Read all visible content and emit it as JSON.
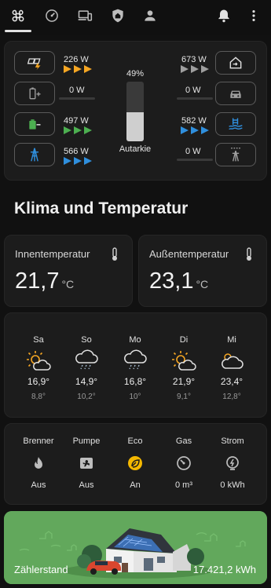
{
  "nav": {
    "tabs": [
      "commands-icon",
      "speedometer-icon",
      "devices-icon",
      "home-shield-icon",
      "person-icon"
    ],
    "active_tab": 0,
    "right": [
      "bell-icon",
      "more-vert-icon"
    ]
  },
  "energy": {
    "solar": {
      "value": "226 W",
      "icon": "solar-power-icon",
      "color": "#f5a623"
    },
    "battery_charge": {
      "value": "0 W",
      "icon": "battery-plus-icon"
    },
    "battery_discharge": {
      "value": "497 W",
      "icon": "battery-minus-icon",
      "color": "#4caf50"
    },
    "grid_import": {
      "value": "566 W",
      "icon": "transmission-tower-icon",
      "color": "#2f8fdd"
    },
    "house": {
      "value": "673 W",
      "icon": "home-import-icon"
    },
    "car": {
      "value": "0 W",
      "icon": "car-icon"
    },
    "pool": {
      "value": "582 W",
      "icon": "pool-heat-icon",
      "color": "#2f8fdd"
    },
    "grid_export": {
      "value": "0 W",
      "icon": "transmission-tower-export-icon"
    },
    "autarkie": {
      "percent_label": "49%",
      "fraction": 0.49,
      "label": "Autarkie"
    }
  },
  "section_title": "Klima und Temperatur",
  "temps": [
    {
      "label": "Innentemperatur",
      "value": "21,7",
      "unit": "°C"
    },
    {
      "label": "Außentemperatur",
      "value": "23,1",
      "unit": "°C"
    }
  ],
  "forecast": [
    {
      "day": "Sa",
      "icon": "partly-cloudy-day-icon",
      "hi": "16,9°",
      "lo": "8,8°"
    },
    {
      "day": "So",
      "icon": "rainy-icon",
      "hi": "14,9°",
      "lo": "10,2°"
    },
    {
      "day": "Mo",
      "icon": "rainy-icon",
      "hi": "16,8°",
      "lo": "10°"
    },
    {
      "day": "Di",
      "icon": "partly-cloudy-day-icon",
      "hi": "21,9°",
      "lo": "9,1°"
    },
    {
      "day": "Mi",
      "icon": "cloudy-icon",
      "hi": "23,4°",
      "lo": "12,8°"
    }
  ],
  "heating": [
    {
      "name": "Brenner",
      "icon": "fire-icon",
      "state": "Aus"
    },
    {
      "name": "Pumpe",
      "icon": "pump-icon",
      "state": "Aus"
    },
    {
      "name": "Eco",
      "icon": "leaf-circle-icon",
      "state": "An",
      "color": "#f5b800"
    },
    {
      "name": "Gas",
      "icon": "gauge-icon",
      "state": "0 m³"
    },
    {
      "name": "Strom",
      "icon": "meter-electric-icon",
      "state": "0 kWh"
    }
  ],
  "meter": {
    "label": "Zählerstand",
    "value": "17.421,2 kWh"
  }
}
